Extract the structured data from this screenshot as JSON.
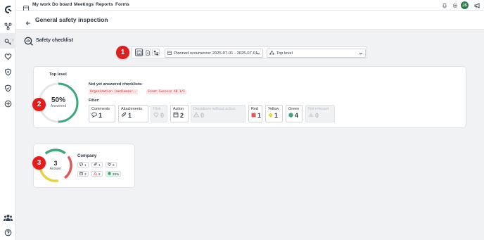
{
  "nav": {
    "items": [
      "My work",
      "Do board",
      "Meetings",
      "Reports",
      "Forms"
    ],
    "avatar_initials": "JS"
  },
  "page": {
    "title": "General safety inspection",
    "section_title": "Safety checklist"
  },
  "toolbar": {
    "occurrence": "Planned occurrence: 2025-07-01 - 2025-07-01",
    "level": "Top level"
  },
  "badges": [
    "1",
    "2",
    "3"
  ],
  "summary": {
    "label": "Top level",
    "percent": "50%",
    "percent_value": 50,
    "answered_label": "Answered",
    "not_yet_label": "Not yet answered checklists:",
    "pending": [
      "Organization (medlemser..",
      "Great Success AB 1/1"
    ],
    "filter_label": "Filter:",
    "filters": [
      {
        "label": "Comments",
        "value": "1",
        "icon": "comment-icon",
        "disabled": false
      },
      {
        "label": "Attachments",
        "value": "1",
        "icon": "paperclip-icon",
        "disabled": false
      },
      {
        "label": "Risk",
        "value": "0",
        "icon": "heart-icon",
        "disabled": true
      },
      {
        "label": "Action",
        "value": "2",
        "icon": "calendar-icon",
        "disabled": false
      },
      {
        "label": "Deviations without action",
        "value": "0",
        "icon": "warning-icon",
        "disabled": true
      },
      {
        "label": "Red",
        "value": "1",
        "icon": "red-square-icon",
        "disabled": false
      },
      {
        "label": "Yellow",
        "value": "1",
        "icon": "yellow-diamond-icon",
        "disabled": false
      },
      {
        "label": "Green",
        "value": "4",
        "icon": "green-circle-icon",
        "disabled": false
      },
      {
        "label": "Not relevant",
        "value": "0",
        "icon": "not-relevant-icon",
        "disabled": true
      }
    ]
  },
  "company": {
    "answered": "3",
    "answered_label": "Answer",
    "name": "Company",
    "stats": {
      "comments": "1",
      "attachments": "1",
      "risk": "6",
      "actions": "3",
      "deviations": "8",
      "green": "33%"
    }
  },
  "colors": {
    "green": "#3aa87a",
    "red": "#e05a5a",
    "yellow": "#e8d33a",
    "grey": "#e4e6e9",
    "badge": "#e21d1d"
  }
}
